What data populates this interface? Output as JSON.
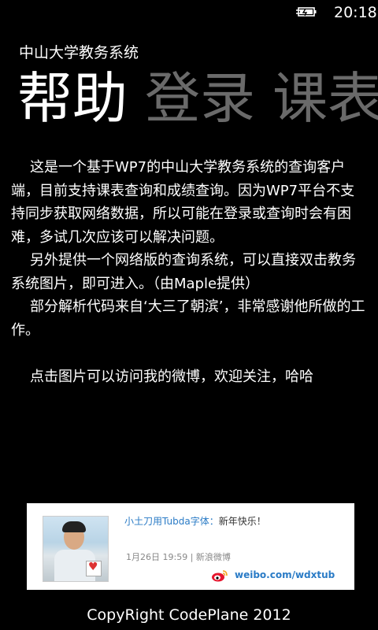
{
  "status_bar": {
    "time": "20:18",
    "battery_icon": "battery-charging-icon"
  },
  "app": {
    "title": "中山大学教务系统"
  },
  "pivot": {
    "items": [
      {
        "label": "帮助",
        "active": true
      },
      {
        "label": "登录",
        "active": false
      },
      {
        "label": "课表",
        "active": false
      }
    ]
  },
  "help": {
    "paragraphs": [
      "这是一个基于WP7的中山大学教务系统的查询客户端，目前支持课表查询和成绩查询。因为WP7平台不支持同步获取网络数据，所以可能在登录或查询时会有困难，多试几次应该可以解决问题。",
      "另外提供一个网络版的查询系统，可以直接双击教务系统图片，即可进入。（由Maple提供）",
      "部分解析代码来自‘大三了朝滨’，非常感谢他所做的工作。"
    ],
    "weibo_prompt": "点击图片可以访问我的微博，欢迎关注，哈哈"
  },
  "weibo_card": {
    "author": "小土刀用Tubda字体：",
    "message": "新年快乐！",
    "meta": "1月26日 19:59 | 新浪微博",
    "url": "weibo.com/wdxtub",
    "logo_icon": "weibo-logo-icon"
  },
  "footer": {
    "copyright": "CopyRight CodePlane 2012"
  },
  "colors": {
    "background": "#000000",
    "inactive_pivot": "#6a6a6a",
    "link_blue": "#2a7bc6"
  }
}
